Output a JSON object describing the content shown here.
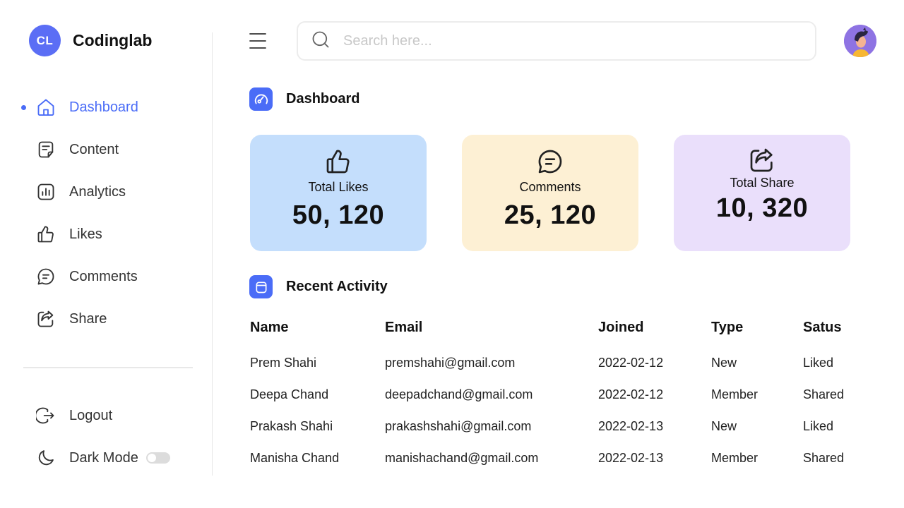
{
  "brand": {
    "initials": "CL",
    "name": "Codinglab",
    "accent": "#5b6ef5"
  },
  "sidebar": {
    "items": [
      {
        "label": "Dashboard",
        "icon": "home-icon",
        "active": true
      },
      {
        "label": "Content",
        "icon": "note-icon",
        "active": false
      },
      {
        "label": "Analytics",
        "icon": "chart-icon",
        "active": false
      },
      {
        "label": "Likes",
        "icon": "thumbs-up-icon",
        "active": false
      },
      {
        "label": "Comments",
        "icon": "comment-icon",
        "active": false
      },
      {
        "label": "Share",
        "icon": "share-icon",
        "active": false
      }
    ],
    "bottom": [
      {
        "label": "Logout",
        "icon": "logout-icon"
      },
      {
        "label": "Dark Mode",
        "icon": "moon-icon",
        "toggle": false
      }
    ]
  },
  "search": {
    "placeholder": "Search here...",
    "value": ""
  },
  "dashboard": {
    "title": "Dashboard"
  },
  "cards": [
    {
      "title": "Total Likes",
      "value": "50, 120",
      "color": "#c4defc",
      "icon": "thumbs-up-icon"
    },
    {
      "title": "Comments",
      "value": "25, 120",
      "color": "#fdf0d4",
      "icon": "comment-icon"
    },
    {
      "title": "Total Share",
      "value": "10, 320",
      "color": "#eadffb",
      "icon": "share-icon"
    }
  ],
  "activity": {
    "title": "Recent Activity",
    "headers": [
      "Name",
      "Email",
      "Joined",
      "Type",
      "Satus"
    ],
    "rows": [
      [
        "Prem Shahi",
        "premshahi@gmail.com",
        "2022-02-12",
        "New",
        "Liked"
      ],
      [
        "Deepa Chand",
        "deepadchand@gmail.com",
        "2022-02-12",
        "Member",
        "Shared"
      ],
      [
        "Prakash Shahi",
        "prakashshahi@gmail.com",
        "2022-02-13",
        "New",
        "Liked"
      ],
      [
        "Manisha Chand",
        "manishachand@gmail.com",
        "2022-02-13",
        "Member",
        "Shared"
      ]
    ]
  },
  "colors": {
    "accent": "#4a6cf7",
    "text": "#111111",
    "muted": "#333333"
  }
}
